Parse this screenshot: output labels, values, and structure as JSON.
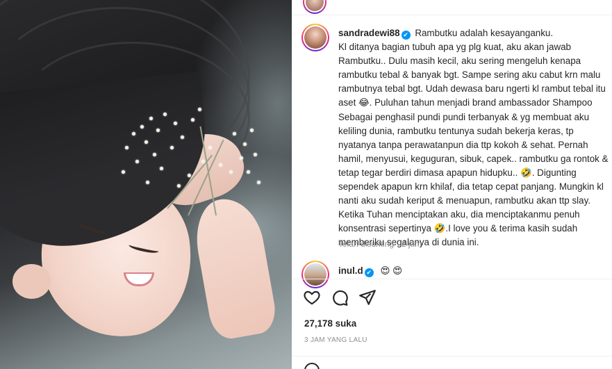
{
  "post": {
    "username": "sandradewi88",
    "caption": "Rambutku adalah kesayanganku.\nKl ditanya bagian tubuh apa yg plg kuat, aku akan jawab Rambutku.. Dulu masih kecil, aku sering mengeluh kenapa rambutku tebal & banyak bgt. Sampe sering aku cabut krn malu rambutnya tebal bgt. Udah dewasa baru ngerti kl rambut tebal itu aset 😂. Puluhan tahun menjadi brand ambassador Shampoo Sebagai penghasil pundi pundi terbanyak & yg membuat aku keliling dunia, rambutku tentunya sudah bekerja keras, tp nyatanya tanpa perawatanpun dia ttp kokoh & sehat. Pernah hamil, menyusui, keguguran, sibuk, capek.. rambutku ga rontok & tetap tegar berdiri dimasa apapun hidupku.. 🤣. Digunting sependek apapun krn khilaf, dia tetap cepat panjang. Mungkin kl nanti aku sudah keriput & menuapun, rambutku akan ttp slay. Ketika Tuhan menciptakan aku, dia menciptakanmu penuh konsentrasi sepertinya 🤣.I love you & terima kasih sudah memberiku segalanya di dunia ini.",
    "edited_meta": "Telah disunting · 2 jam"
  },
  "comment": {
    "username": "inul.d",
    "text": "😍 😍"
  },
  "stats": {
    "likes": "27,178 suka",
    "time_ago": "3 JAM YANG LALU"
  },
  "icons": {
    "verified": "✔",
    "like": "heart-icon",
    "comment": "comment-bubble-icon",
    "share": "paper-plane-icon"
  },
  "colors": {
    "verified": "#0095f6",
    "meta": "#8e8e8e",
    "text": "#262626"
  }
}
